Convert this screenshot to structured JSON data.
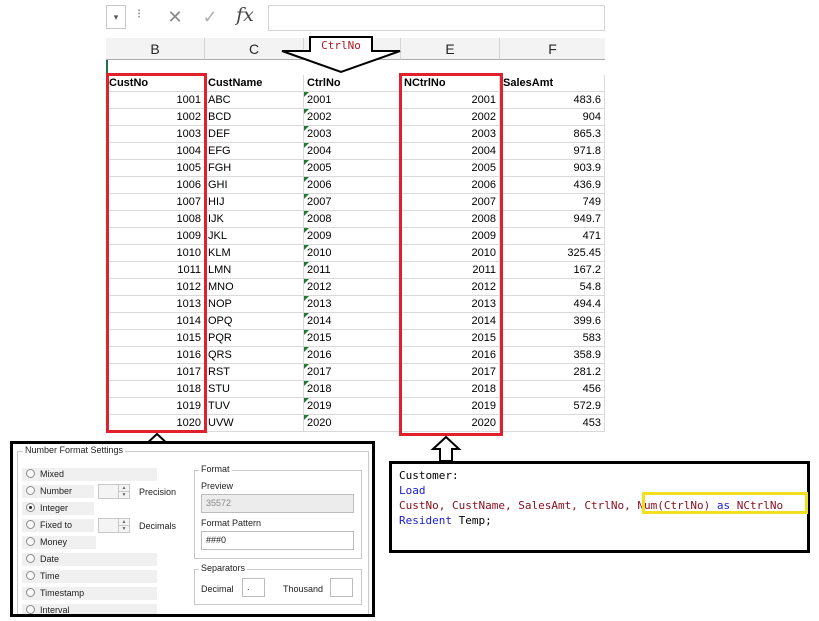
{
  "formula_bar": {
    "dropdown_glyph": "▾",
    "separator_glyph": "⁝",
    "cancel_glyph": "✕",
    "enter_glyph": "✓",
    "function_label": "fx",
    "formula_value": ""
  },
  "columns": [
    "B",
    "C",
    "",
    "E",
    "F"
  ],
  "arrow_top_label": "CtrlNo",
  "headers": [
    "CustNo",
    "CustName",
    "CtrlNo",
    "NCtrlNo",
    "SalesAmt"
  ],
  "rows": [
    {
      "custno": "1001",
      "custname": "ABC",
      "ctrlno": "2001",
      "nctrlno": "2001",
      "sales": "483.6"
    },
    {
      "custno": "1002",
      "custname": "BCD",
      "ctrlno": "2002",
      "nctrlno": "2002",
      "sales": "904"
    },
    {
      "custno": "1003",
      "custname": "DEF",
      "ctrlno": "2003",
      "nctrlno": "2003",
      "sales": "865.3"
    },
    {
      "custno": "1004",
      "custname": "EFG",
      "ctrlno": "2004",
      "nctrlno": "2004",
      "sales": "971.8"
    },
    {
      "custno": "1005",
      "custname": "FGH",
      "ctrlno": "2005",
      "nctrlno": "2005",
      "sales": "903.9"
    },
    {
      "custno": "1006",
      "custname": "GHI",
      "ctrlno": "2006",
      "nctrlno": "2006",
      "sales": "436.9"
    },
    {
      "custno": "1007",
      "custname": "HIJ",
      "ctrlno": "2007",
      "nctrlno": "2007",
      "sales": "749"
    },
    {
      "custno": "1008",
      "custname": "IJK",
      "ctrlno": "2008",
      "nctrlno": "2008",
      "sales": "949.7"
    },
    {
      "custno": "1009",
      "custname": "JKL",
      "ctrlno": "2009",
      "nctrlno": "2009",
      "sales": "471"
    },
    {
      "custno": "1010",
      "custname": "KLM",
      "ctrlno": "2010",
      "nctrlno": "2010",
      "sales": "325.45"
    },
    {
      "custno": "1011",
      "custname": "LMN",
      "ctrlno": "2011",
      "nctrlno": "2011",
      "sales": "167.2"
    },
    {
      "custno": "1012",
      "custname": "MNO",
      "ctrlno": "2012",
      "nctrlno": "2012",
      "sales": "54.8"
    },
    {
      "custno": "1013",
      "custname": "NOP",
      "ctrlno": "2013",
      "nctrlno": "2013",
      "sales": "494.4"
    },
    {
      "custno": "1014",
      "custname": "OPQ",
      "ctrlno": "2014",
      "nctrlno": "2014",
      "sales": "399.6"
    },
    {
      "custno": "1015",
      "custname": "PQR",
      "ctrlno": "2015",
      "nctrlno": "2015",
      "sales": "583"
    },
    {
      "custno": "1016",
      "custname": "QRS",
      "ctrlno": "2016",
      "nctrlno": "2016",
      "sales": "358.9"
    },
    {
      "custno": "1017",
      "custname": "RST",
      "ctrlno": "2017",
      "nctrlno": "2017",
      "sales": "281.2"
    },
    {
      "custno": "1018",
      "custname": "STU",
      "ctrlno": "2018",
      "nctrlno": "2018",
      "sales": "456"
    },
    {
      "custno": "1019",
      "custname": "TUV",
      "ctrlno": "2019",
      "nctrlno": "2019",
      "sales": "572.9"
    },
    {
      "custno": "1020",
      "custname": "UVW",
      "ctrlno": "2020",
      "nctrlno": "2020",
      "sales": "453"
    }
  ],
  "format_dialog": {
    "title": "Number Format Settings",
    "options": [
      "Mixed",
      "Number",
      "Integer",
      "Fixed to",
      "Money",
      "Date",
      "Time",
      "Timestamp",
      "Interval"
    ],
    "selected": "Integer",
    "precision_label": "Precision",
    "decimals_label": "Decimals",
    "format_group": "Format",
    "preview_label": "Preview",
    "preview_value": "35572",
    "pattern_label": "Format Pattern",
    "pattern_value": "###0",
    "separators_group": "Separators",
    "decimal_label": "Decimal",
    "decimal_value": ".",
    "thousand_label": "Thousand",
    "thousand_value": ""
  },
  "script": {
    "line1": "Customer:",
    "line2": "Load",
    "line3_fields": "CustNo, CustName, SalesAmt, CtrlNo, ",
    "line3_func": "Num(CtrlNo)",
    "line3_as": " as ",
    "line3_alias": "NCtrlNo",
    "line4_kw": "Resident",
    "line4_table": " Temp;"
  }
}
